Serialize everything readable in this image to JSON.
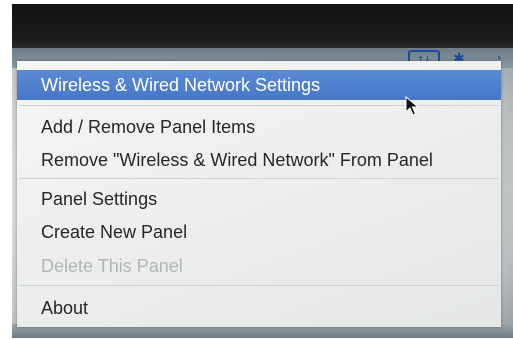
{
  "taskbar": {
    "network_icon": "network-status-icon",
    "network_glyph": "↑↓",
    "bluetooth_icon": "bluetooth-icon",
    "bluetooth_glyph": "✱",
    "tray_icon": "tray-icon",
    "tray_glyph": "◔"
  },
  "menu": {
    "items": [
      {
        "label": "Wireless & Wired Network Settings",
        "state": "highlighted"
      },
      {
        "label": "Add / Remove Panel Items",
        "state": "normal"
      },
      {
        "label": "Remove \"Wireless & Wired Network\" From Panel",
        "state": "normal"
      },
      {
        "label": "Panel Settings",
        "state": "normal"
      },
      {
        "label": "Create New Panel",
        "state": "normal"
      },
      {
        "label": "Delete This Panel",
        "state": "disabled"
      },
      {
        "label": "About",
        "state": "normal"
      }
    ]
  },
  "colors": {
    "highlight": "#4f80cc",
    "menu_text": "#262626",
    "disabled_text": "#b2b5b7"
  }
}
